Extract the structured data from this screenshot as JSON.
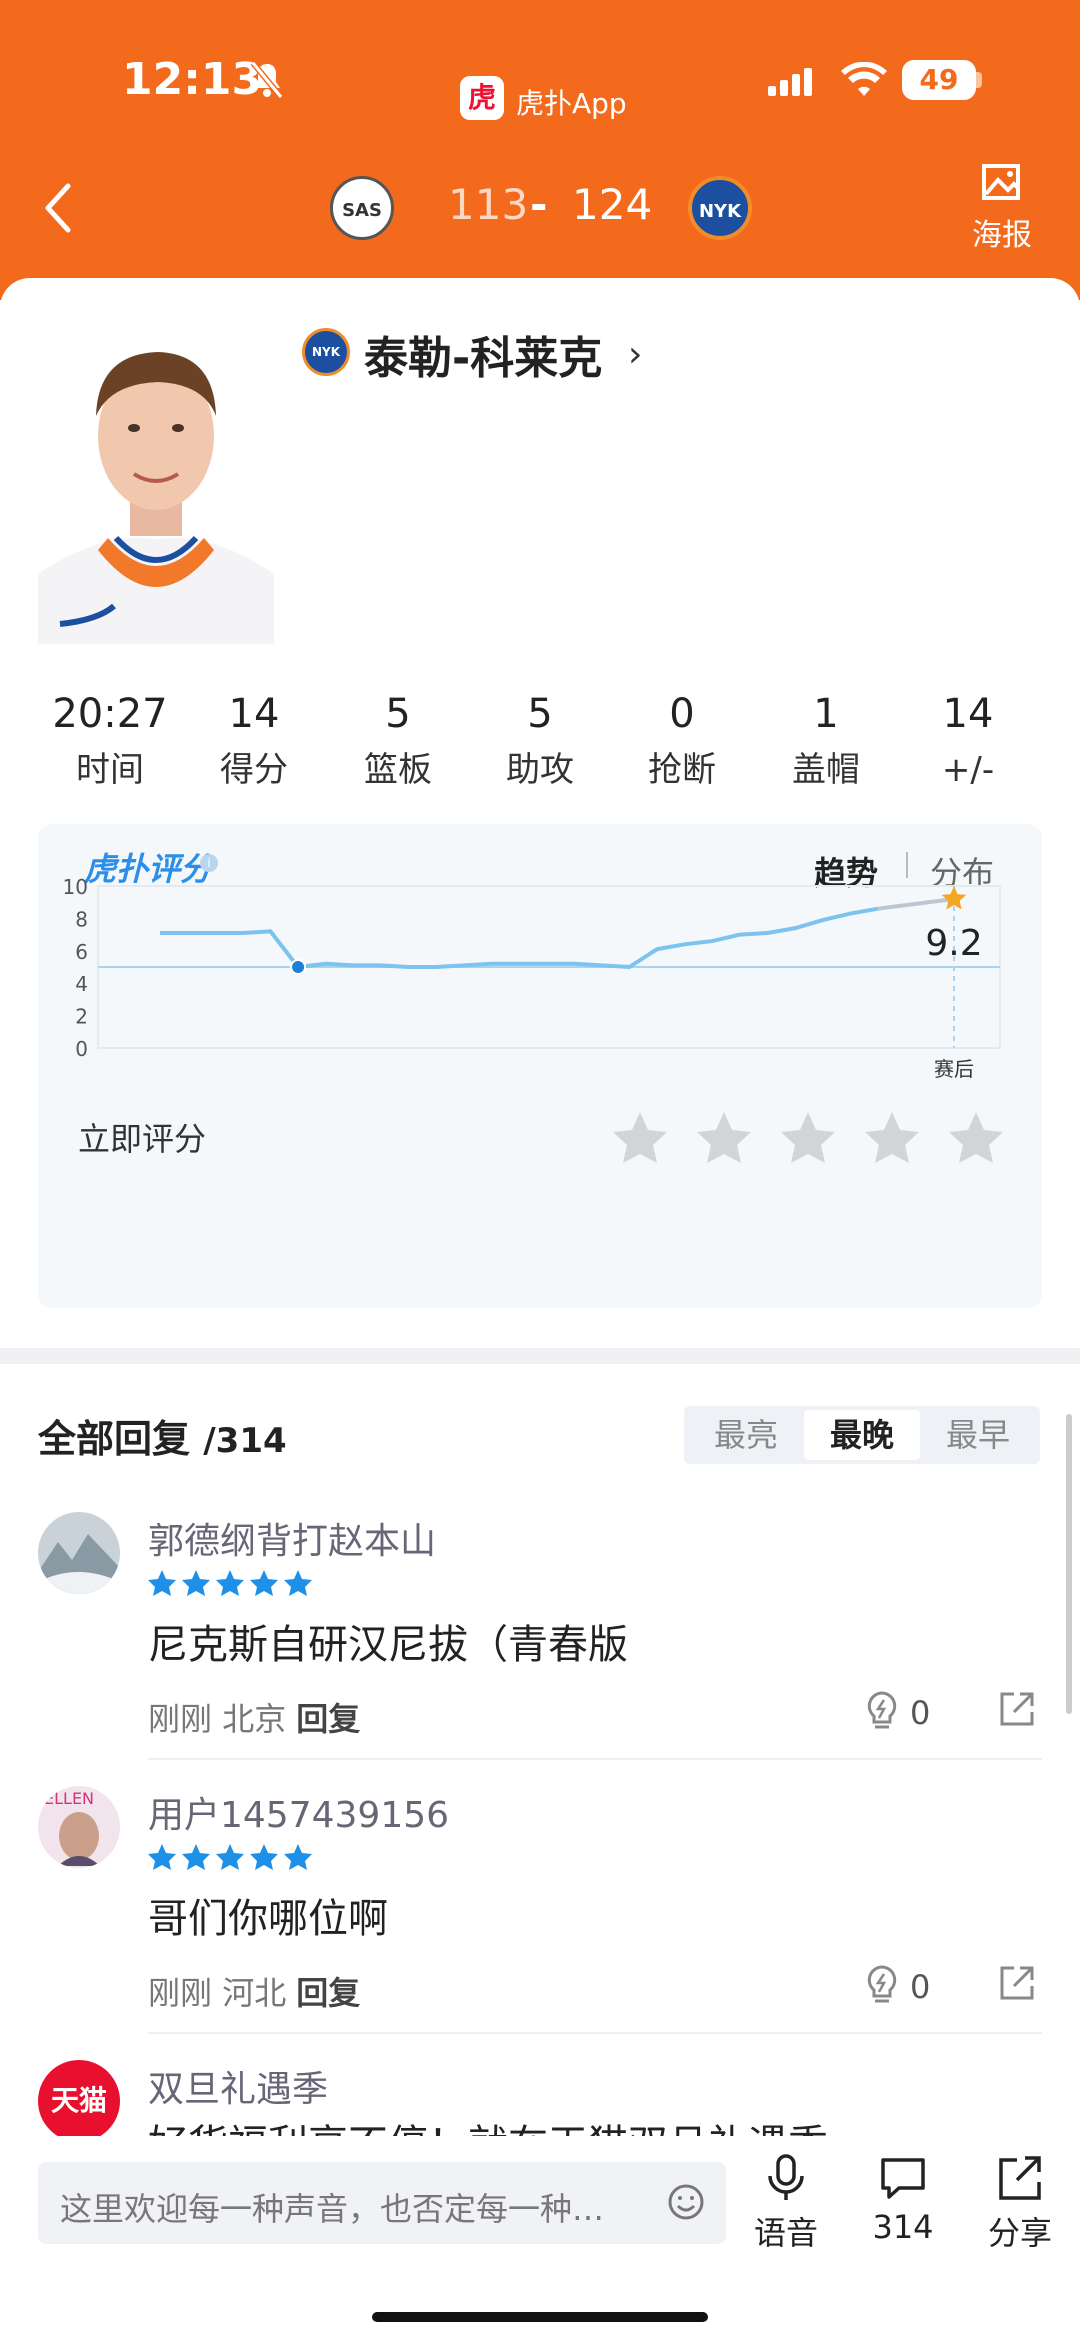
{
  "status": {
    "time": "12:13",
    "battery": "49"
  },
  "app": {
    "badge": "虎",
    "name": "虎扑App"
  },
  "game": {
    "home_team": "SAS",
    "home_score": "113",
    "separator": "-",
    "away_score": "124",
    "away_team": "NYK",
    "poster_label": "海报"
  },
  "player": {
    "name": "泰勒-科莱克",
    "team": "NYK"
  },
  "stats": [
    {
      "value": "20:27",
      "label": "时间"
    },
    {
      "value": "14",
      "label": "得分"
    },
    {
      "value": "5",
      "label": "篮板"
    },
    {
      "value": "5",
      "label": "助攻"
    },
    {
      "value": "0",
      "label": "抢断"
    },
    {
      "value": "1",
      "label": "盖帽"
    },
    {
      "value": "14",
      "label": "+/-"
    }
  ],
  "rating": {
    "logo": "虎扑评分",
    "tab_trend": "趋势",
    "tab_dist": "分布",
    "rate_now": "立即评分"
  },
  "chart_data": {
    "type": "line",
    "ylim": [
      0,
      10
    ],
    "yticks": [
      "0",
      "2",
      "4",
      "6",
      "8",
      "10"
    ],
    "xlabel_end": "赛后",
    "final_value": "9.2",
    "reference_line": 5,
    "values": [
      7.1,
      7.1,
      7.1,
      7.1,
      7.2,
      5.0,
      5.2,
      5.1,
      5.1,
      5.0,
      5.0,
      5.1,
      5.2,
      5.2,
      5.2,
      5.2,
      5.1,
      5.0,
      6.1,
      6.4,
      6.6,
      7.0,
      7.1,
      7.4,
      7.9,
      8.3,
      8.6
    ]
  },
  "comments": {
    "title": "全部回复",
    "count": "/314",
    "sort_tabs": [
      "最亮",
      "最晚",
      "最早"
    ],
    "active_sort": 1,
    "items": [
      {
        "user": "郭德纲背打赵本山",
        "text": "尼克斯自研汉尼拔（青春版",
        "time": "刚刚",
        "location": "北京",
        "reply": "回复",
        "likes": "0"
      },
      {
        "user": "用户1457439156",
        "text": "哥们你哪位啊",
        "time": "刚刚",
        "location": "河北",
        "reply": "回复",
        "likes": "0"
      }
    ],
    "ad": {
      "avatar": "天猫",
      "title": "双旦礼遇季",
      "text": "好货福利享不停！就在天猫双旦礼遇季"
    }
  },
  "bottom": {
    "placeholder": "这里欢迎每一种声音，也否定每一种…",
    "voice": "语音",
    "comments": "314",
    "share": "分享"
  },
  "colors": {
    "brand": "#f36a1c",
    "rating_blue": "#2b8ee8",
    "star_gold": "#f5a623",
    "star_blue": "#1e90e8"
  }
}
